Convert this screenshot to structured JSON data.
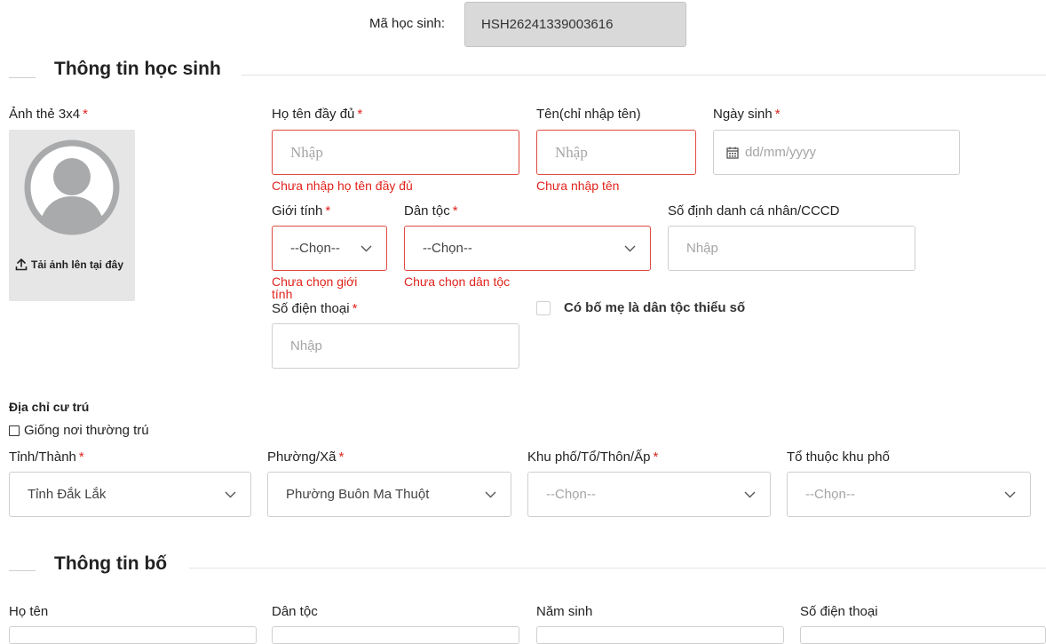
{
  "student_code": {
    "label": "Mã học sinh:",
    "value": "HSH26241339003616"
  },
  "student_section": {
    "title": "Thông tin học sinh"
  },
  "photo": {
    "label": "Ảnh thẻ 3x4",
    "upload_text": "Tải ảnh lên tại đây"
  },
  "required_mark": "*",
  "full_name": {
    "label": "Họ tên đầy đủ",
    "placeholder": "Nhập",
    "error": "Chưa nhập họ tên đầy đủ"
  },
  "first_name": {
    "label": "Tên(chỉ nhập tên)",
    "placeholder": "Nhập",
    "error": "Chưa nhập tên"
  },
  "birth_date": {
    "label": "Ngày sinh",
    "placeholder": "dd/mm/yyyy"
  },
  "gender": {
    "label": "Giới tính",
    "value": "--Chọn--",
    "error": "Chưa chọn giới tính"
  },
  "ethnicity": {
    "label": "Dân tộc",
    "value": "--Chọn--",
    "error": "Chưa chọn dân tộc"
  },
  "id_number": {
    "label": "Số định danh cá nhân/CCCD",
    "placeholder": "Nhập"
  },
  "phone": {
    "label": "Số điện thoại",
    "placeholder": "Nhập"
  },
  "minority_parent": {
    "label": "Có bố mẹ là dân tộc thiểu số",
    "checked": false
  },
  "address": {
    "heading": "Địa chỉ cư trú",
    "same_as_permanent": "Giống nơi thường trú",
    "province": {
      "label": "Tỉnh/Thành",
      "value": "Tỉnh Đắk Lắk"
    },
    "ward": {
      "label": "Phường/Xã",
      "value": "Phường Buôn Ma Thuột"
    },
    "hamlet": {
      "label": "Khu phố/Tổ/Thôn/Ấp",
      "value": "--Chọn--"
    },
    "group": {
      "label": "Tổ thuộc khu phố",
      "value": "--Chọn--"
    }
  },
  "father_section": {
    "title": "Thông tin bố",
    "name_label": "Họ tên",
    "ethnicity_label": "Dân tộc",
    "birth_year_label": "Năm sinh",
    "phone_label": "Số điện thoại"
  }
}
